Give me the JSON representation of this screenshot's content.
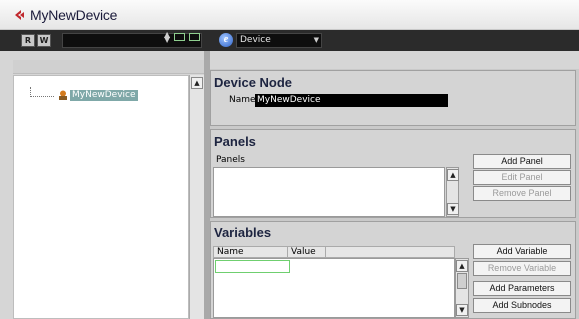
{
  "window": {
    "title": "MyNewDevice"
  },
  "toolbar": {
    "r_label": "R",
    "w_label": "W",
    "device_icon_glyph": "e",
    "device_select_value": "Device"
  },
  "tree": {
    "root_label": "MyNewDevice"
  },
  "device_node": {
    "title": "Device Node",
    "name_label": "Name",
    "name_value": "MyNewDevice"
  },
  "panels": {
    "title": "Panels",
    "list_header": "Panels",
    "buttons": {
      "add": "Add Panel",
      "edit": "Edit Panel",
      "remove": "Remove Panel"
    }
  },
  "variables": {
    "title": "Variables",
    "columns": [
      "Name",
      "Value"
    ],
    "buttons": {
      "add": "Add Variable",
      "remove": "Remove Variable",
      "add_parameters": "Add Parameters",
      "add_subnodes": "Add Subnodes"
    }
  },
  "colors": {
    "toolbar_bg": "#2b2b2b",
    "title_icon": "#c0282d",
    "selection": "#7fa8a8",
    "field_bg": "#000000"
  },
  "icons": {
    "app": "app-logo-icon",
    "up_down": "up-down-arrows-icon",
    "device": "device-e-icon",
    "tree_node": "device-node-icon"
  }
}
